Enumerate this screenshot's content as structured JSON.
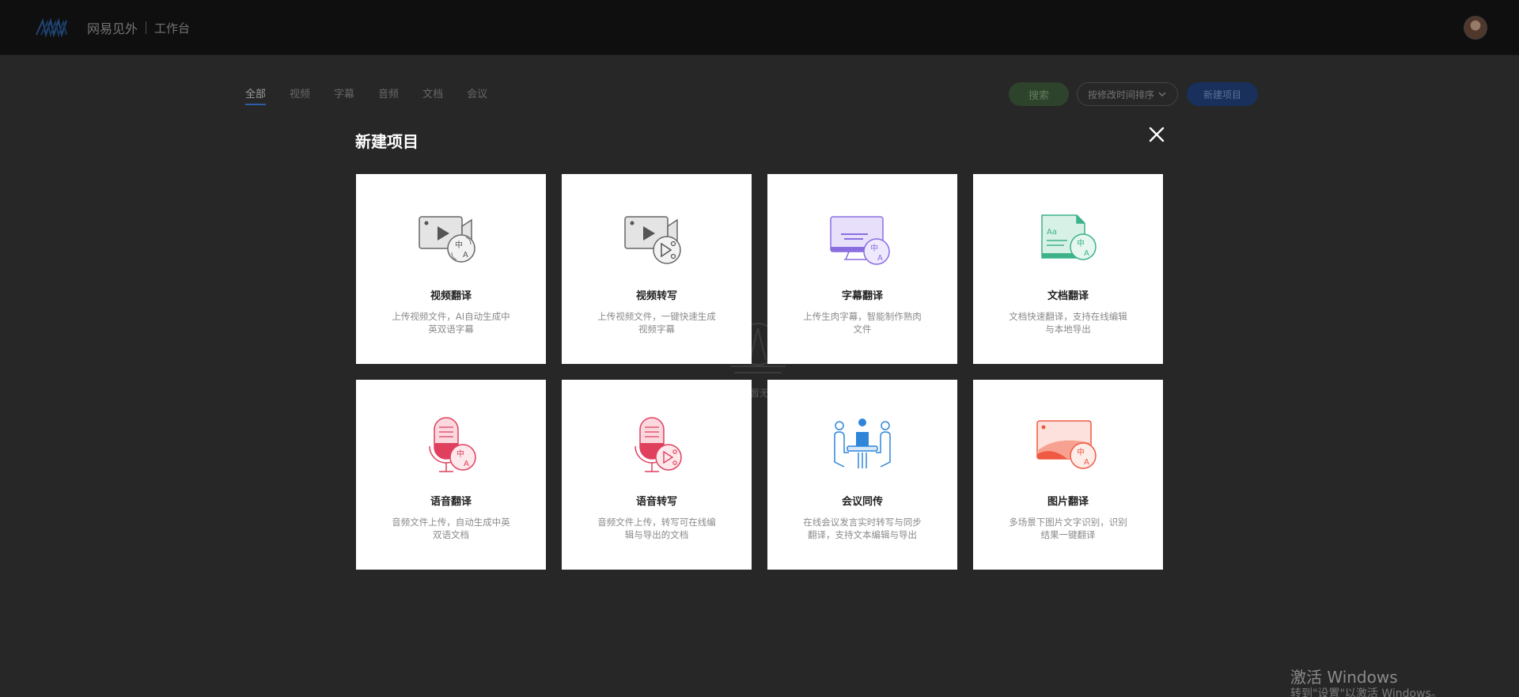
{
  "header": {
    "brand": "网易见外",
    "sub": "工作台"
  },
  "tabs": [
    {
      "label": "全部",
      "active": true
    },
    {
      "label": "视频"
    },
    {
      "label": "字幕"
    },
    {
      "label": "音频"
    },
    {
      "label": "文档"
    },
    {
      "label": "会议"
    }
  ],
  "toolbar": {
    "search_label": "搜索",
    "sort_label": "按修改时间排序",
    "new_label": "新建项目"
  },
  "background": {
    "empty_text": "暂无"
  },
  "modal": {
    "title": "新建项目",
    "cards": [
      {
        "title": "视频翻译",
        "desc": "上传视频文件，AI自动生成中英双语字幕",
        "icon": "video-translate-icon"
      },
      {
        "title": "视频转写",
        "desc": "上传视频文件，一键快速生成视频字幕",
        "icon": "video-transcribe-icon"
      },
      {
        "title": "字幕翻译",
        "desc": "上传生肉字幕，智能制作熟肉文件",
        "icon": "subtitle-translate-icon"
      },
      {
        "title": "文档翻译",
        "desc": "文档快速翻译，支持在线编辑与本地导出",
        "icon": "document-translate-icon"
      },
      {
        "title": "语音翻译",
        "desc": "音频文件上传，自动生成中英双语文档",
        "icon": "audio-translate-icon"
      },
      {
        "title": "语音转写",
        "desc": "音频文件上传，转写可在线编辑与导出的文档",
        "icon": "audio-transcribe-icon"
      },
      {
        "title": "会议同传",
        "desc": "在线会议发言实时转写与同步翻译，支持文本编辑与导出",
        "icon": "meeting-interpret-icon"
      },
      {
        "title": "图片翻译",
        "desc": "多场景下图片文字识别，识别结果一键翻译",
        "icon": "image-translate-icon"
      }
    ]
  },
  "watermark": {
    "title": "激活 Windows",
    "sub": "转到\"设置\"以激活 Windows。"
  },
  "colors": {
    "video": "#555555",
    "subtitle": "#8a6ee0",
    "document": "#3bb28a",
    "audio": "#e0405e",
    "meeting": "#2f86d9",
    "image": "#ef5a44"
  }
}
